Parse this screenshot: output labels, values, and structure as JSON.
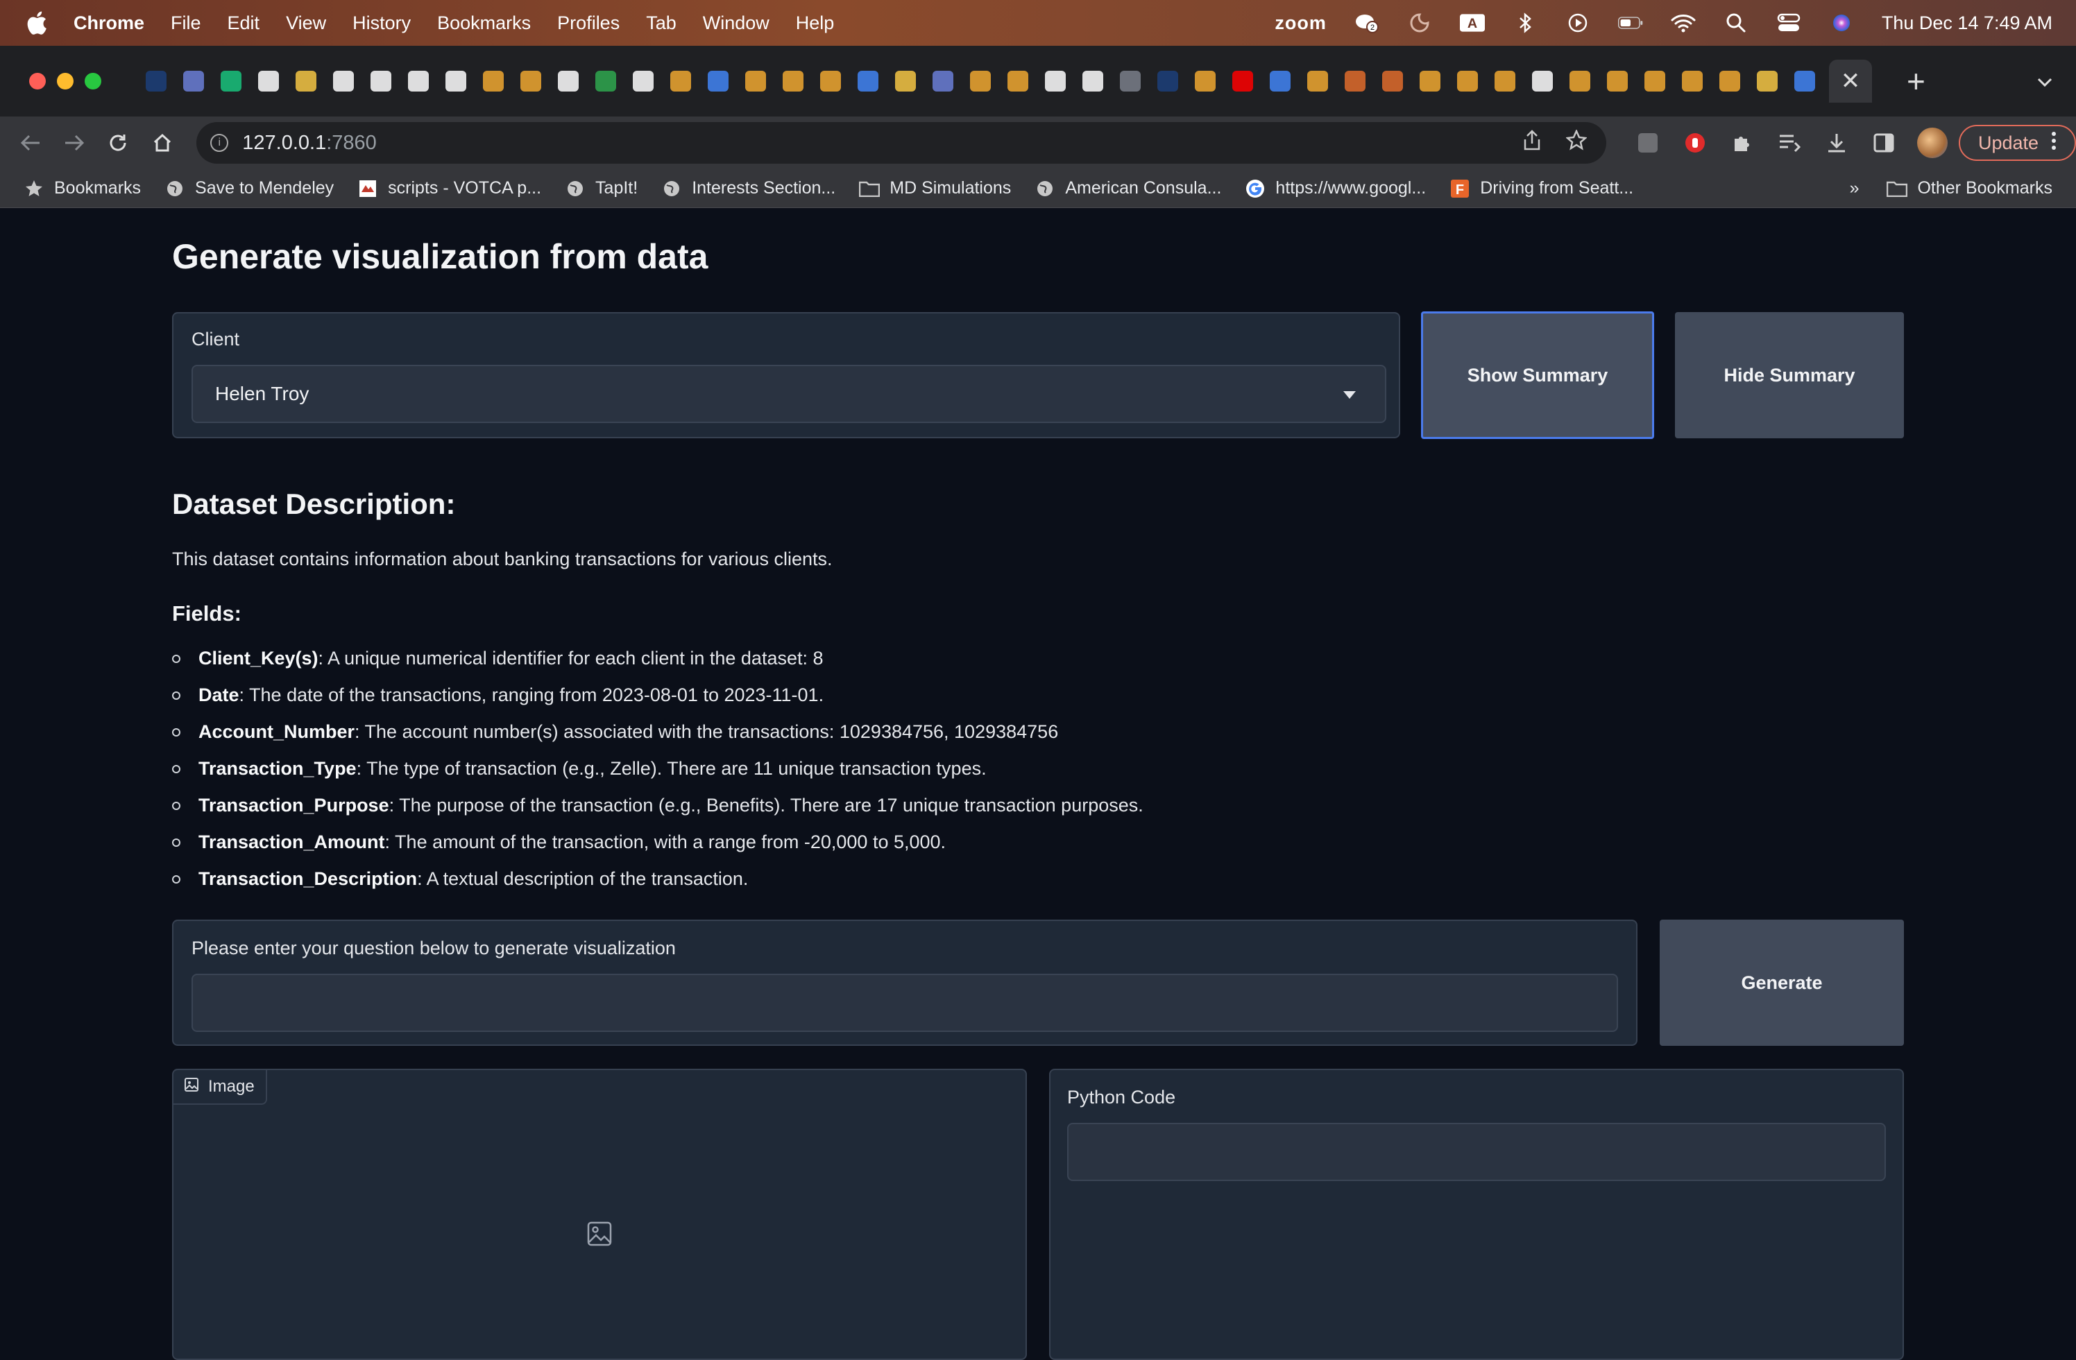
{
  "menubar": {
    "app": "Chrome",
    "items": [
      "File",
      "Edit",
      "View",
      "History",
      "Bookmarks",
      "Profiles",
      "Tab",
      "Window",
      "Help"
    ],
    "zoom": "zoom",
    "datetime": "Thu Dec 14  7:49 AM",
    "badge": "A",
    "icons": [
      "zoom-icon",
      "chat-notification-icon",
      "focus-icon",
      "keyboard-a-icon",
      "bluetooth-icon",
      "play-icon",
      "battery-icon",
      "wifi-icon",
      "search-icon",
      "control-center-icon",
      "siri-icon"
    ]
  },
  "browser": {
    "url_host": "127.0.0.1",
    "url_port": ":7860",
    "update_label": "Update",
    "favicon_colors": [
      "#1c3f7a",
      "#6b7fd7",
      "#19c37d",
      "#ffffff",
      "#f6c744",
      "#ffffff",
      "#ffffff",
      "#ffffff",
      "#ffffff",
      "#f0a830",
      "#f0a830",
      "#ffffff",
      "#2fa84f",
      "#ffffff",
      "#f0a830",
      "#4285f4",
      "#f0a830",
      "#f0a830",
      "#f0a830",
      "#4285f4",
      "#f6c744",
      "#6b7fd7",
      "#f0a830",
      "#f0a830",
      "#ffffff",
      "#ffffff",
      "#7a7f8a",
      "#1c3f7a",
      "#f0a830",
      "#ff0000",
      "#4285f4",
      "#f0a830",
      "#e06c2c",
      "#e06c2c",
      "#f0a830",
      "#f0a830",
      "#f0a830",
      "#ffffff",
      "#f0a830",
      "#f0a830",
      "#f0a830",
      "#f0a830",
      "#f0a830",
      "#f6c744",
      "#4285f4"
    ]
  },
  "bookmarks": [
    {
      "label": "Bookmarks",
      "icon": "star-icon"
    },
    {
      "label": "Save to Mendeley",
      "icon": "globe-icon"
    },
    {
      "label": "scripts - VOTCA p...",
      "icon": "site-icon"
    },
    {
      "label": "TapIt!",
      "icon": "globe-icon"
    },
    {
      "label": "Interests Section...",
      "icon": "globe-icon"
    },
    {
      "label": "MD Simulations",
      "icon": "folder-icon"
    },
    {
      "label": "American Consula...",
      "icon": "globe-icon"
    },
    {
      "label": "https://www.googl...",
      "icon": "google-icon"
    },
    {
      "label": "Driving from Seatt...",
      "icon": "f-icon"
    }
  ],
  "other_bookmarks": "Other Bookmarks",
  "more_chevron": "»",
  "app": {
    "title": "Generate visualization from data",
    "client_label": "Client",
    "client_value": "Helen Troy",
    "show_summary": "Show Summary",
    "hide_summary": "Hide Summary",
    "dataset_heading": "Dataset Description:",
    "dataset_text": "This dataset contains information about banking transactions for various clients.",
    "fields_heading": "Fields:",
    "fields": [
      {
        "name": "Client_Key(s)",
        "desc": ": A unique numerical identifier for each client in the dataset: 8"
      },
      {
        "name": "Date",
        "desc": ": The date of the transactions, ranging from 2023-08-01 to 2023-11-01."
      },
      {
        "name": "Account_Number",
        "desc": ": The account number(s) associated with the transactions: 1029384756, 1029384756"
      },
      {
        "name": "Transaction_Type",
        "desc": ": The type of transaction (e.g., Zelle). There are 11 unique transaction types."
      },
      {
        "name": "Transaction_Purpose",
        "desc": ": The purpose of the transaction (e.g., Benefits). There are 17 unique transaction purposes."
      },
      {
        "name": "Transaction_Amount",
        "desc": ": The amount of the transaction, with a range from -20,000 to 5,000."
      },
      {
        "name": "Transaction_Description",
        "desc": ": A textual description of the transaction."
      }
    ],
    "question_label": "Please enter your question below to generate visualization",
    "question_value": "",
    "generate": "Generate",
    "image_tab": "Image",
    "python_code_label": "Python Code",
    "python_code_value": ""
  }
}
